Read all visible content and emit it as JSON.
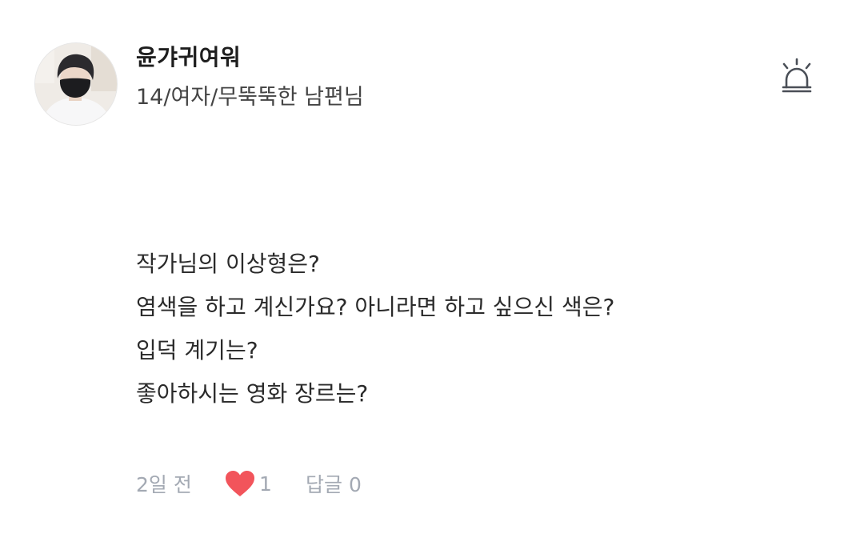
{
  "comment": {
    "author": {
      "username": "윤갸귀여워",
      "bio": "14/여자/무뚝뚝한 남편님",
      "avatar_icon": "profile-photo"
    },
    "report_icon": "siren-icon",
    "lines": [
      "작가님의 이상형은?",
      "염색을 하고 계신가요?  아니라면 하고 싶으신 색은?",
      "입덕 계기는?",
      "좋아하시는 영화 장르는?"
    ],
    "meta": {
      "date": "2일 전",
      "like_icon": "heart-icon",
      "like_count": "1",
      "reply_label": "답글 0"
    },
    "colors": {
      "heart": "#f2545b",
      "meta_text": "#a3a9b3",
      "icon_stroke": "#4a4f57"
    }
  }
}
